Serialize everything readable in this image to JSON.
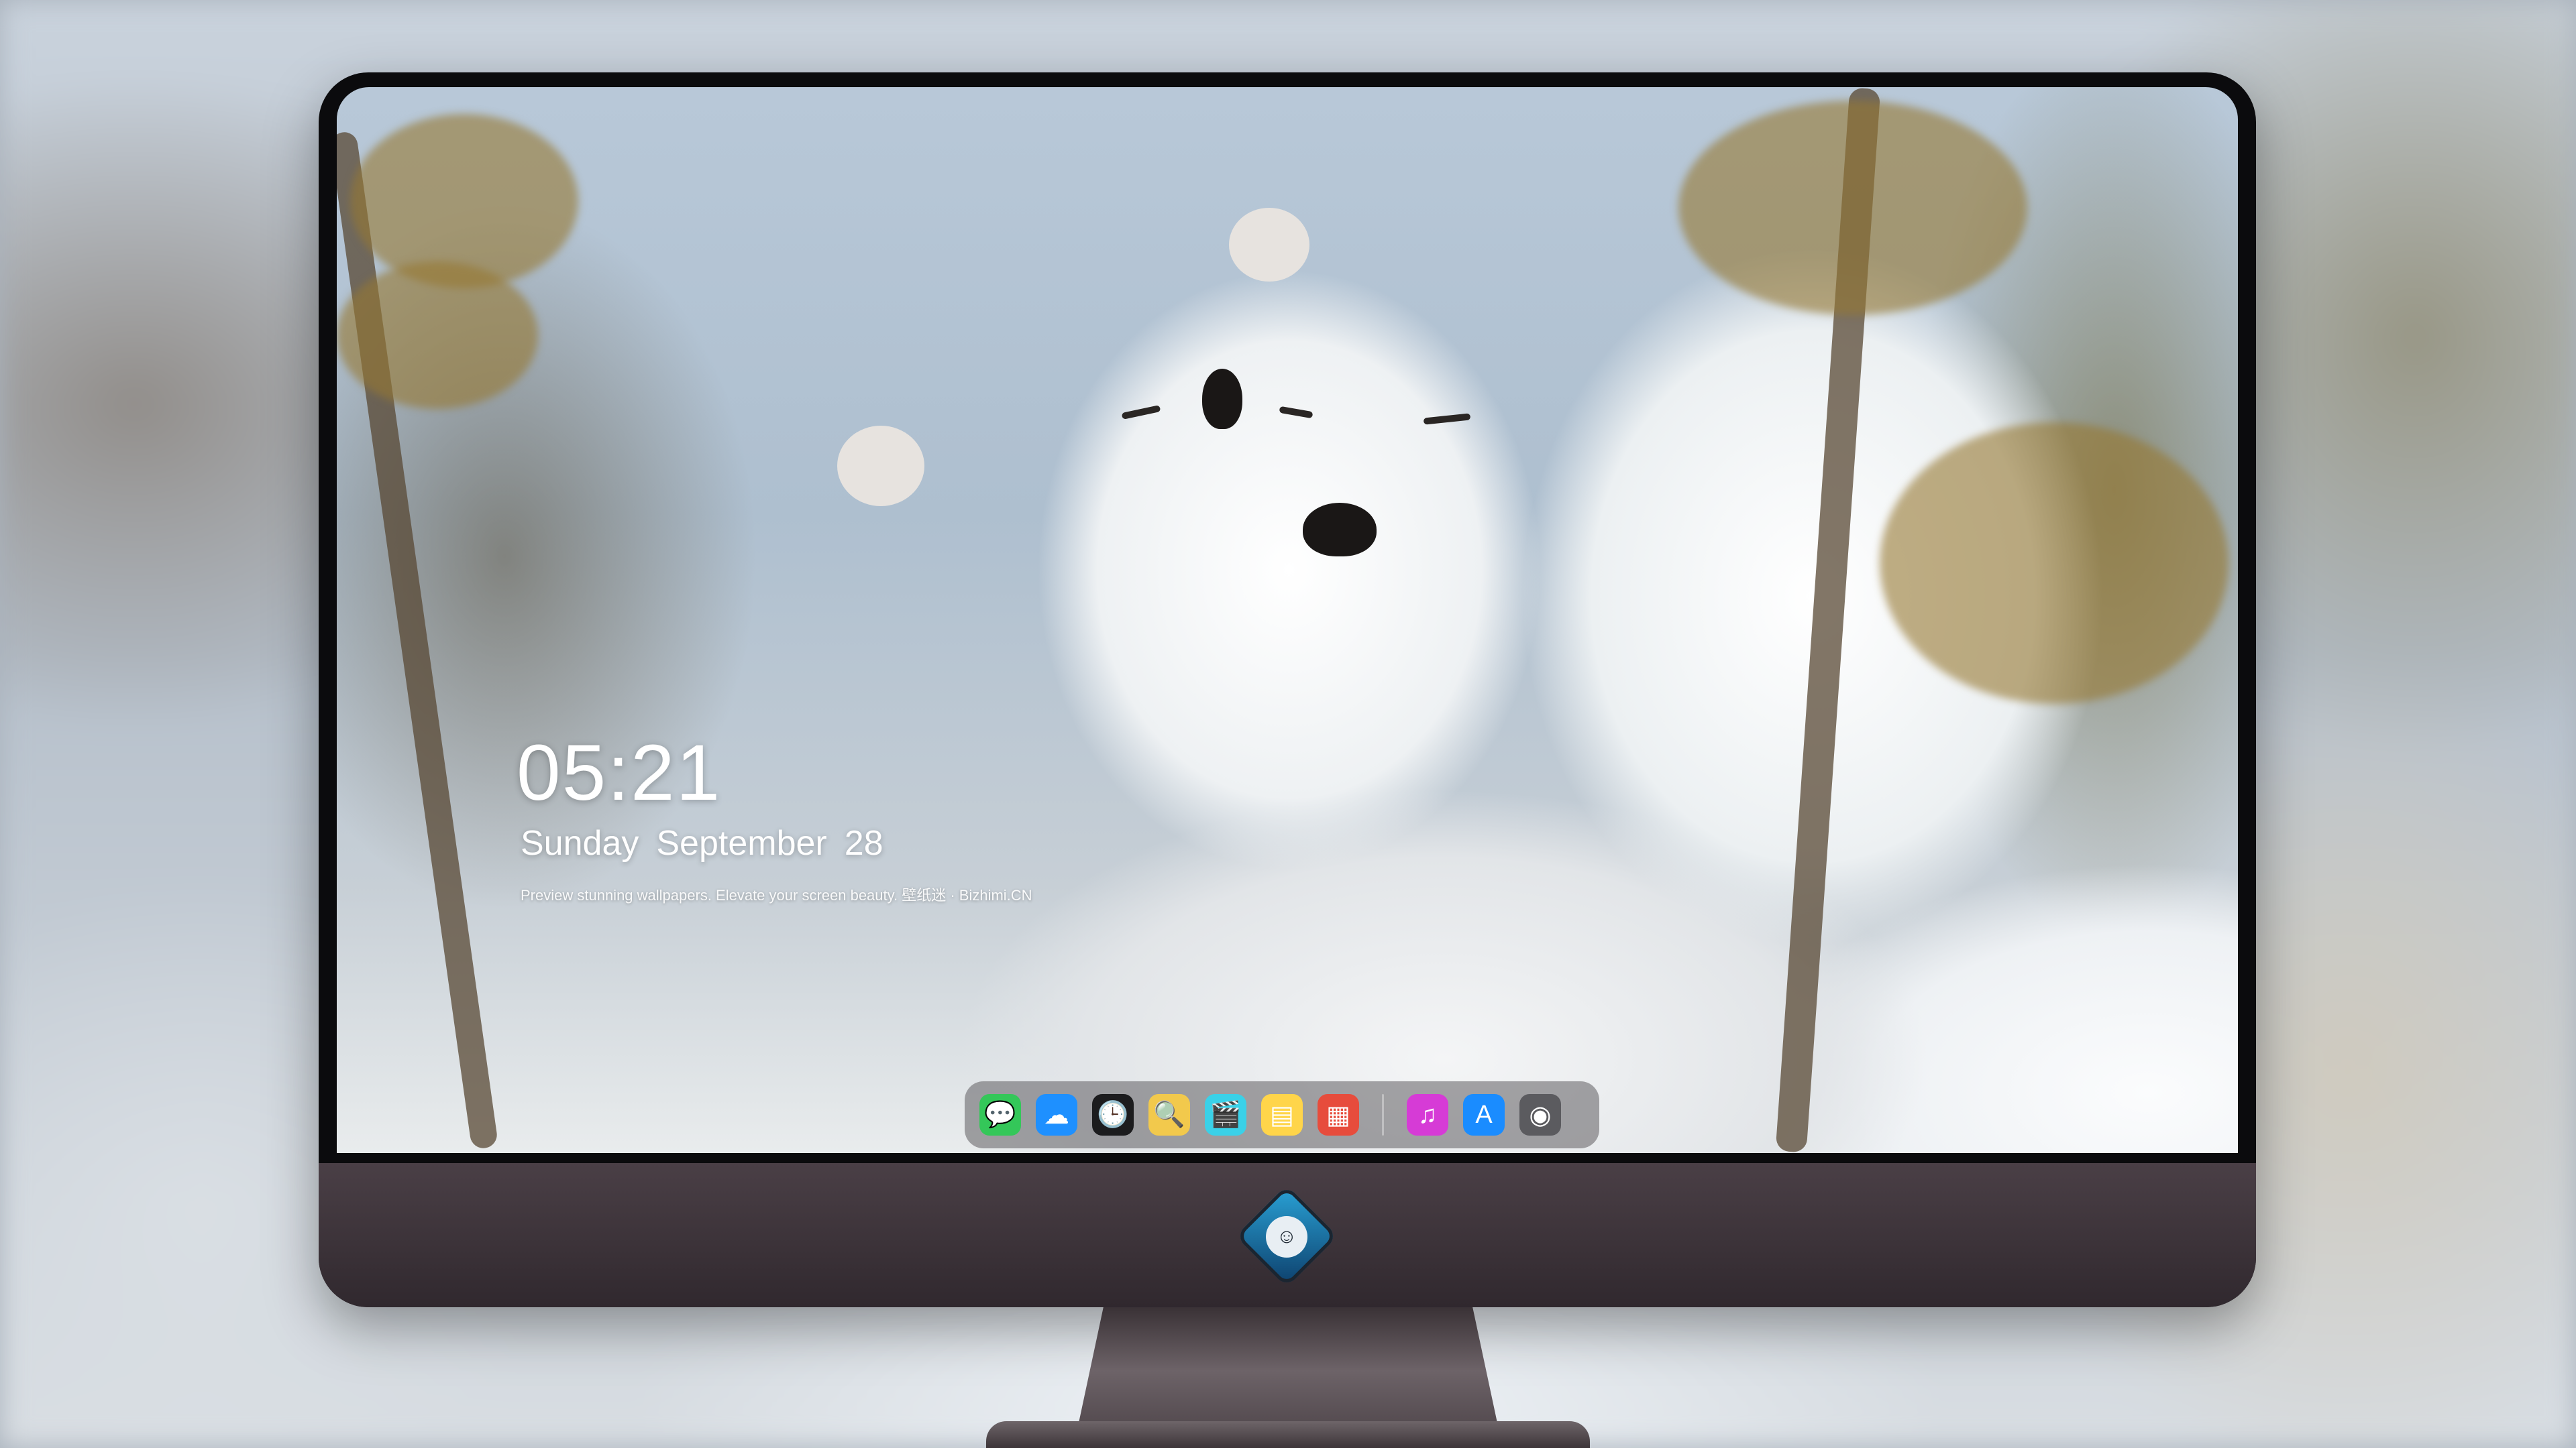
{
  "lockscreen": {
    "time": "05:21",
    "weekday": "Sunday",
    "month": "September",
    "day": "28",
    "tagline": "Preview stunning wallpapers. Elevate your screen beauty. 壁纸迷 · Bizhimi.CN"
  },
  "dock": {
    "items": [
      {
        "name": "messages-icon",
        "glyph": "💬",
        "color": "#34c759"
      },
      {
        "name": "weather-icon",
        "glyph": "☁",
        "color": "#1e90ff"
      },
      {
        "name": "clock-icon",
        "glyph": "🕒",
        "color": "#1c1c1e"
      },
      {
        "name": "preview-icon",
        "glyph": "🔍",
        "color": "#f2c94c"
      },
      {
        "name": "claquette-icon",
        "glyph": "🎬",
        "color": "#3ad1e8"
      },
      {
        "name": "notes-icon",
        "glyph": "▤",
        "color": "#ffd54a"
      },
      {
        "name": "photo-booth-icon",
        "glyph": "▦",
        "color": "#e74c3c"
      },
      {
        "name": "music-icon",
        "glyph": "♫",
        "color": "#d63bd6"
      },
      {
        "name": "app-store-icon",
        "glyph": "A",
        "color": "#1a8cff"
      },
      {
        "name": "screenshot-icon",
        "glyph": "◉",
        "color": "#5b5b5f"
      }
    ],
    "separator_after": 7
  },
  "colors": {
    "bezel": "#0b0b0d",
    "chin": "#3b3238",
    "text": "#ffffff"
  }
}
